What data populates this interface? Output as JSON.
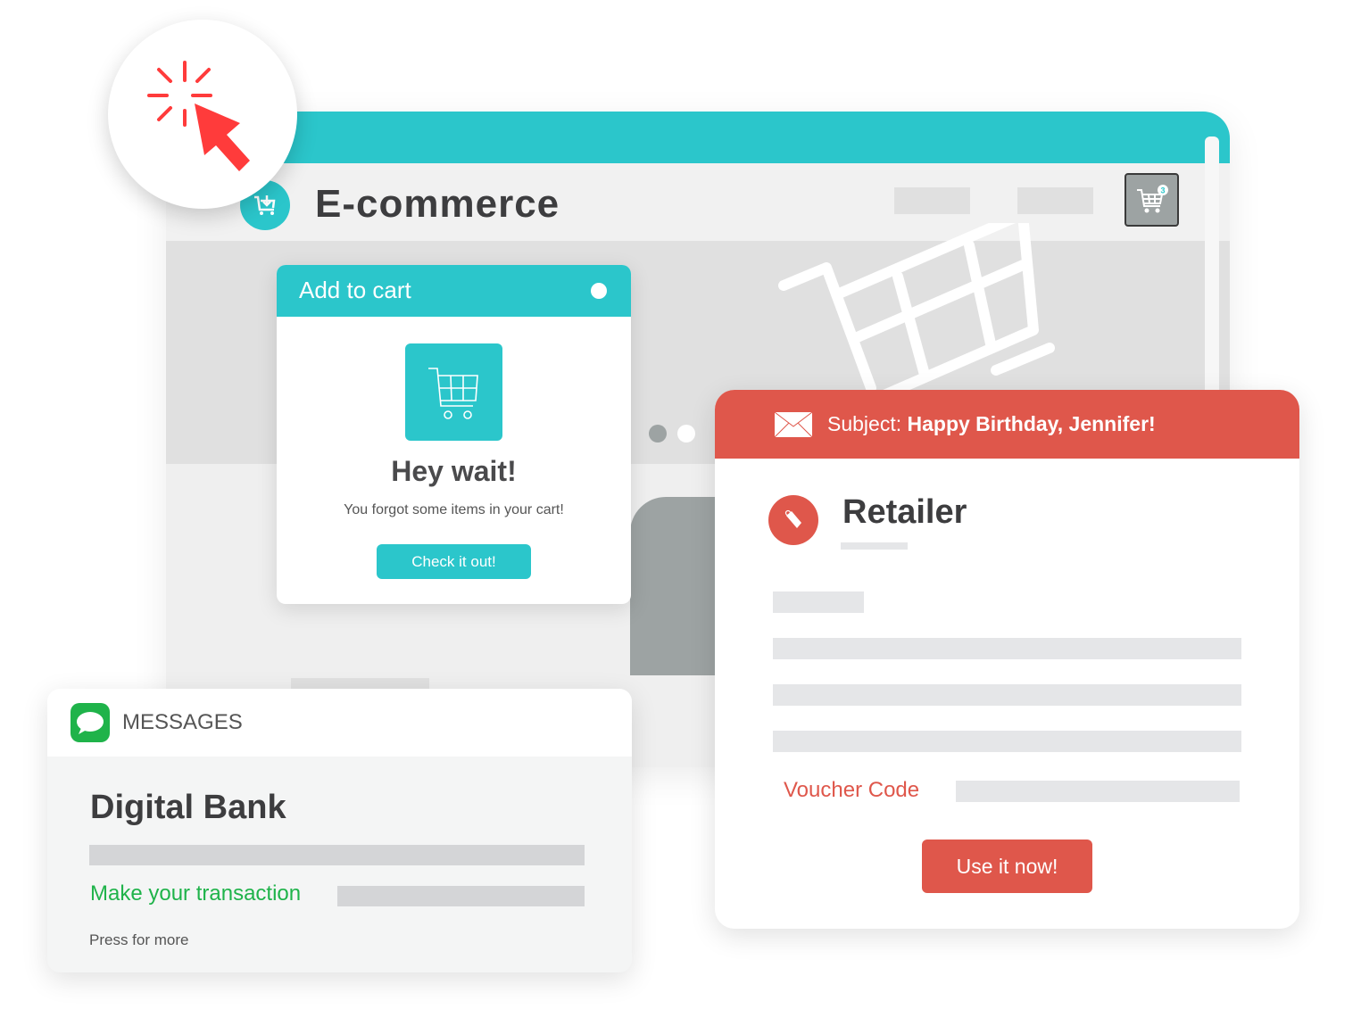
{
  "browser": {
    "title": "E-commerce",
    "cart_count": "3"
  },
  "popup": {
    "header": "Add to cart",
    "heading": "Hey wait!",
    "message": "You forgot some items in your cart!",
    "button": "Check it out!"
  },
  "email": {
    "subject_label": "Subject:",
    "subject": "Happy Birthday, Jennifer!",
    "sender": "Retailer",
    "voucher_label": "Voucher Code",
    "button": "Use it now!"
  },
  "messages": {
    "app": "MESSAGES",
    "sender": "Digital Bank",
    "link": "Make your transaction",
    "hint": "Press for more"
  },
  "colors": {
    "teal": "#2bc6cb",
    "red": "#df574b",
    "green": "#1fb34a",
    "cursor": "#ff3b3b"
  }
}
